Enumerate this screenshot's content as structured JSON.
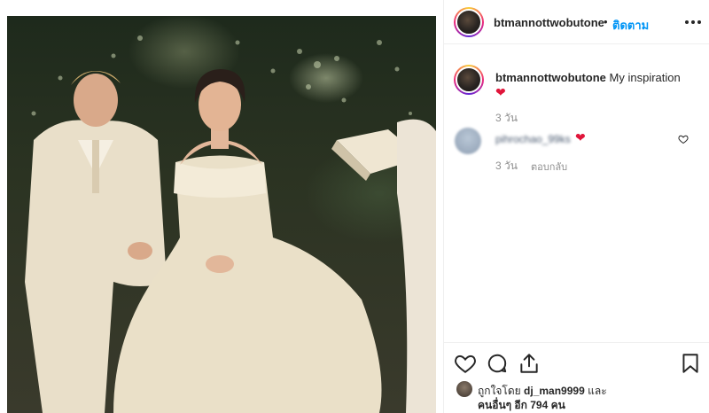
{
  "header": {
    "username": "btmannottwobutone",
    "separator": "•",
    "follow_label": "ติดตาม",
    "more_icon": "more-horizontal-icon"
  },
  "caption": {
    "username": "btmannottwobutone",
    "text": "My inspiration",
    "emoji": "❤",
    "time": "3 วัน"
  },
  "comment": {
    "username": "pihrochao_99ks",
    "emoji": "❤",
    "time": "3 วัน",
    "reply_label": "ตอบกลับ",
    "like_icon": "heart-outline-icon"
  },
  "actions": {
    "like_icon": "heart-outline-icon",
    "comment_icon": "comment-bubble-icon",
    "share_icon": "share-upload-icon",
    "save_icon": "bookmark-icon"
  },
  "likes": {
    "prefix": "ถูกใจโดย",
    "user": "dj_man9999",
    "and": "และ",
    "others": "คนอื่นๆ อีก 794 คน"
  },
  "colors": {
    "link_blue": "#0095f6",
    "heart_red": "#e0153a",
    "muted": "#8e8e8e",
    "text": "#262626",
    "divider": "#efefef"
  }
}
